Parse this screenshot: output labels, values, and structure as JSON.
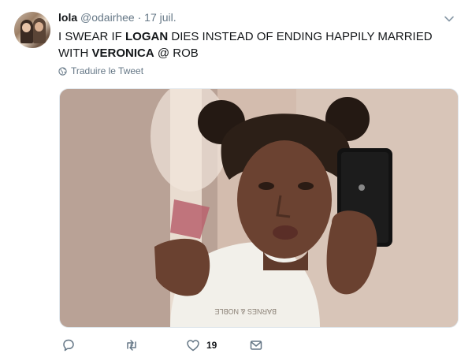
{
  "tweet": {
    "name": "lola",
    "handle": "@odairhee",
    "separator": "·",
    "date": "17 juil.",
    "text": {
      "part1": "I SWEAR IF ",
      "bold1": "LOGAN",
      "part2": " DIES INSTEAD OF ENDING HAPPILY MARRIED WITH ",
      "bold2": "VERONICA",
      "part3": " @ ROB"
    },
    "translate_label": "Traduire le Tweet",
    "shirt_print": "BARNES & NOBLE"
  },
  "actions": {
    "reply_count": "",
    "retweet_count": "",
    "like_count": "19",
    "dm_count": ""
  },
  "icons": {
    "caret": "chevron-down-icon",
    "globe": "globe-icon",
    "reply": "reply-icon",
    "retweet": "retweet-icon",
    "like": "heart-icon",
    "dm": "envelope-icon"
  },
  "colors": {
    "text": "#14171a",
    "secondary": "#657786",
    "border": "#e1e8ed"
  }
}
